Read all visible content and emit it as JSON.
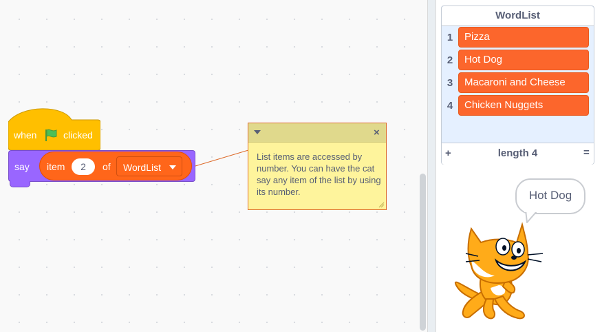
{
  "workspace": {
    "hat_block": {
      "when": "when",
      "clicked": "clicked",
      "flag_icon": "green-flag-icon"
    },
    "say_block": {
      "say": "say",
      "item_label": "item",
      "item_index": "2",
      "of_label": "of",
      "list_name": "WordList"
    },
    "comment": {
      "text": "List items are accessed by number. You can have the cat say any item of the list by using its number.",
      "close": "×"
    }
  },
  "stage": {
    "list_monitor": {
      "title": "WordList",
      "items": [
        {
          "index": "1",
          "value": "Pizza"
        },
        {
          "index": "2",
          "value": "Hot Dog"
        },
        {
          "index": "3",
          "value": "Macaroni and Cheese"
        },
        {
          "index": "4",
          "value": "Chicken Nuggets"
        }
      ],
      "add": "+",
      "length": "length 4",
      "resize": "="
    },
    "speech_bubble": "Hot Dog",
    "sprite": "cat-sprite"
  },
  "colors": {
    "events": "#ffbf00",
    "looks": "#9966ff",
    "data_list": "#ff661a",
    "list_cell": "#fc662c",
    "comment": "#fef49c"
  }
}
